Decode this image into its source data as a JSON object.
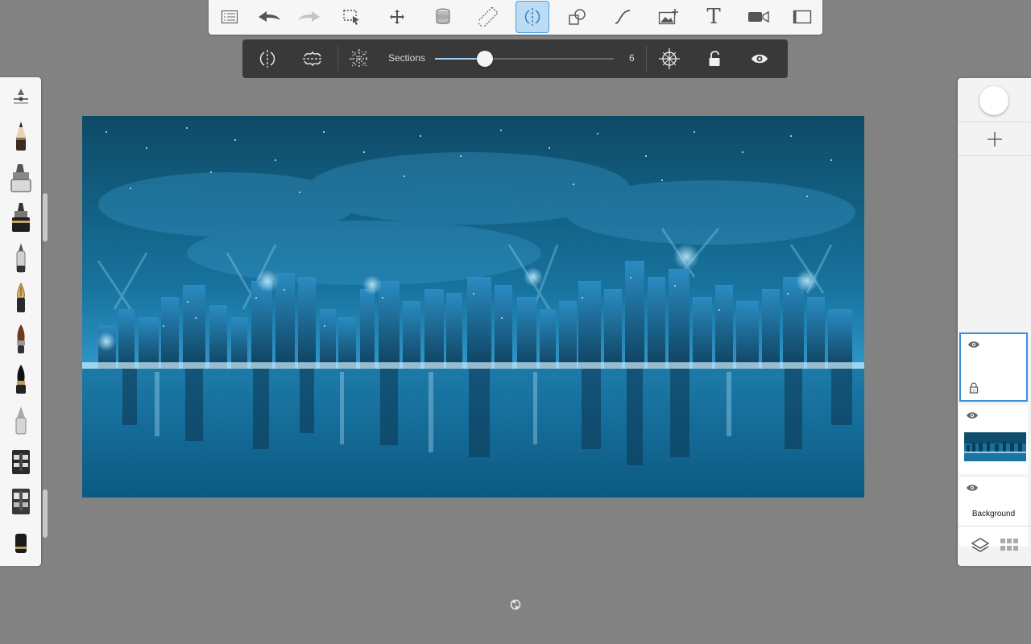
{
  "toolbar": {
    "buttons": [
      {
        "name": "list-icon"
      },
      {
        "name": "undo-icon"
      },
      {
        "name": "redo-icon"
      },
      {
        "name": "selection-icon"
      },
      {
        "name": "transform-icon"
      },
      {
        "name": "fill-icon"
      },
      {
        "name": "ruler-icon"
      },
      {
        "name": "symmetry-icon",
        "active": true
      },
      {
        "name": "shapes-icon"
      },
      {
        "name": "curve-icon"
      },
      {
        "name": "add-image-icon"
      },
      {
        "name": "text-icon"
      },
      {
        "name": "video-icon"
      },
      {
        "name": "fullscreen-icon"
      }
    ],
    "text_glyph": "T"
  },
  "symmetry": {
    "sections_label": "Sections",
    "sections_value": "6",
    "sections_level": 0.28
  },
  "brushes": [
    "selector-icon",
    "pencil-icon",
    "marker-icon",
    "pen-icon",
    "ballpoint-icon",
    "fountain-pen-icon",
    "paintbrush-icon",
    "ink-brush-icon",
    "airbrush-icon",
    "smudge-icon",
    "eraser-icon",
    "chisel-icon"
  ],
  "layers": {
    "items": [
      {
        "name": "layer-1",
        "selected": true,
        "locked": true
      },
      {
        "name": "layer-2-artwork"
      },
      {
        "name": "layer-background",
        "label": "Background"
      }
    ]
  },
  "colors": {
    "accent": "#3c8fe0",
    "canvas_bg": "#828282",
    "toolbar_bg": "#f6f6f6",
    "symmetry_bar_bg": "#393939"
  }
}
